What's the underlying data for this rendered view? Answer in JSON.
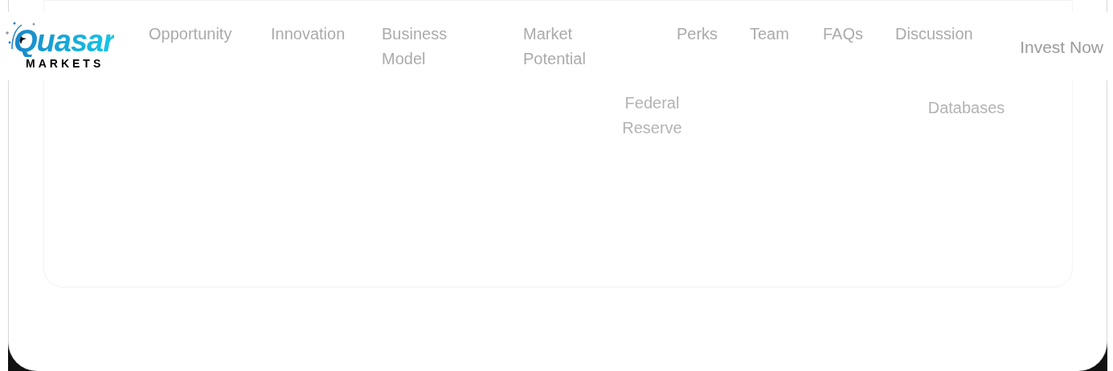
{
  "logo": {
    "name": "Quasar",
    "tagline": "MARKETS"
  },
  "nav": [
    {
      "label": "Opportunity"
    },
    {
      "label": "Innovation"
    },
    {
      "label": "Business Model"
    },
    {
      "label": "Market Potential"
    },
    {
      "label": "Perks"
    },
    {
      "label": "Team"
    },
    {
      "label": "FAQs"
    },
    {
      "label": "Discussion"
    }
  ],
  "cta": {
    "label": "Invest Now"
  },
  "sources": [
    {
      "label": "Federal Reserve"
    },
    {
      "label": "Databases"
    }
  ]
}
